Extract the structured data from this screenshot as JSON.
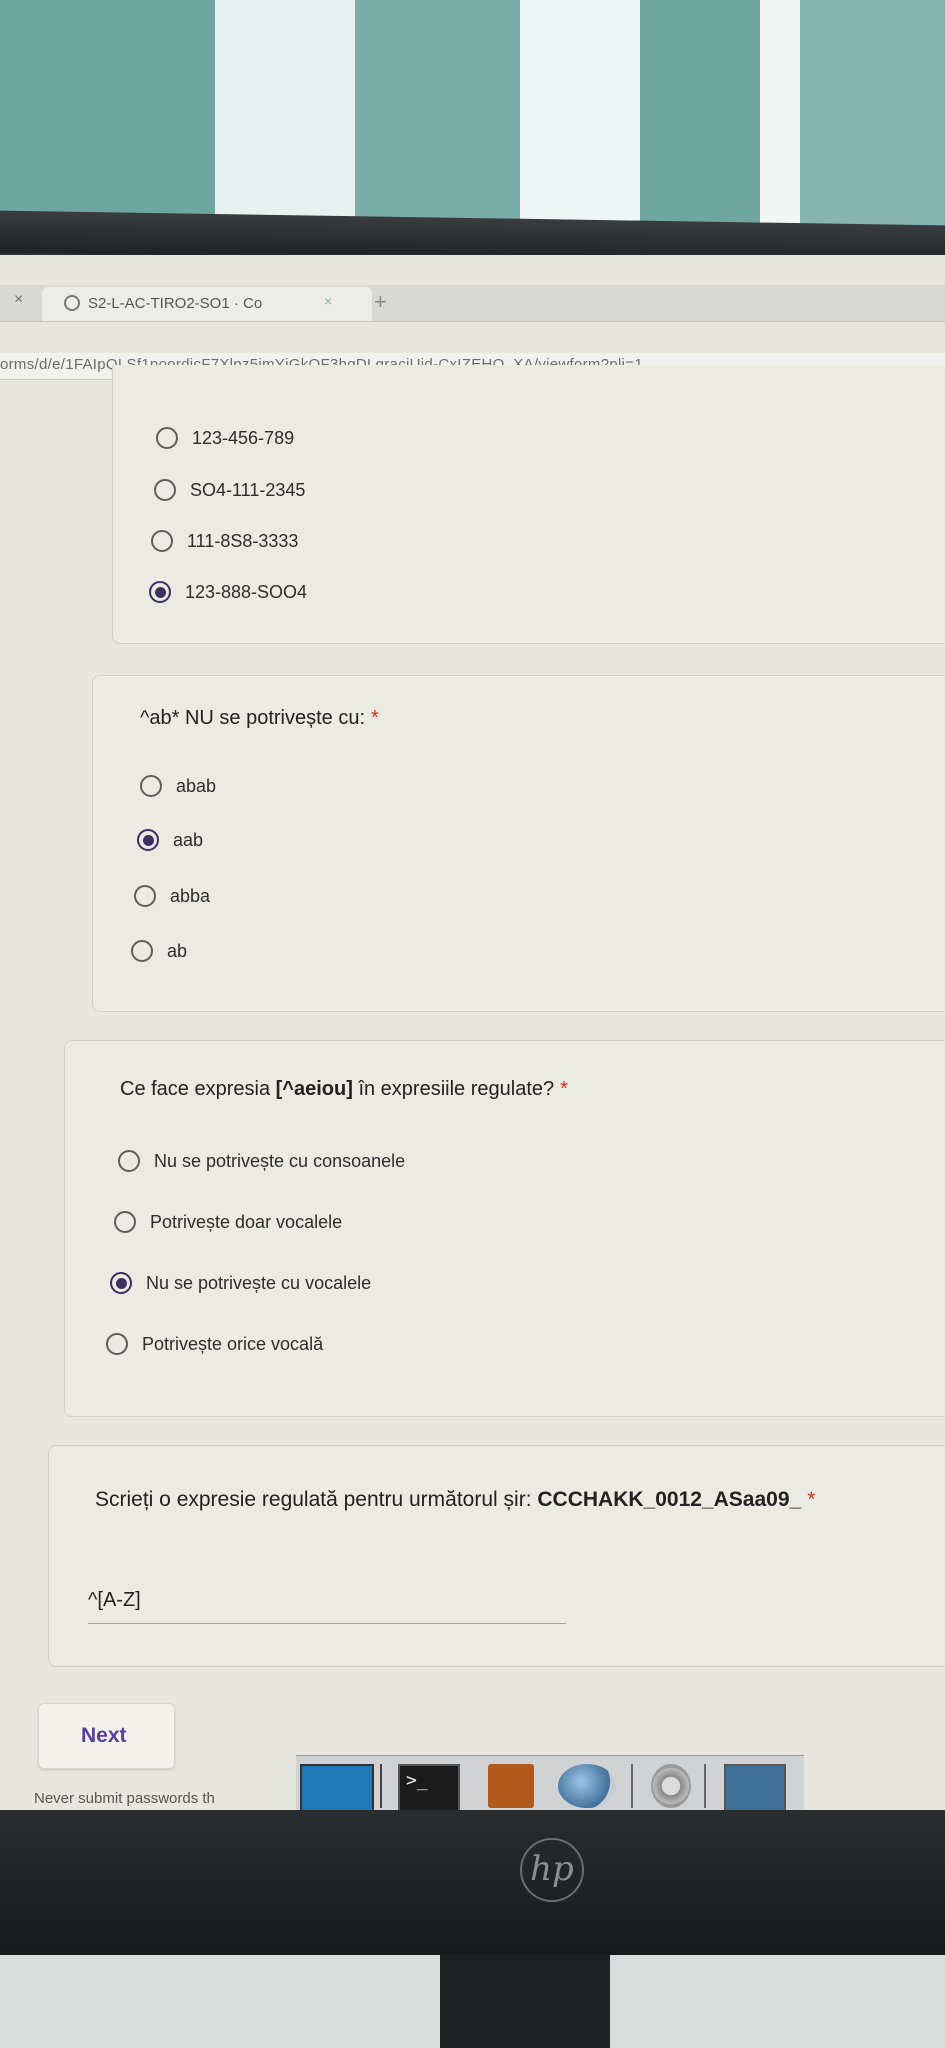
{
  "browser": {
    "tab_close": "×",
    "tab_title": "S2-L-AC-TIRO2-SO1 · Co",
    "tab_x": "×",
    "new_tab": "+",
    "url": "orms/d/e/1FAIpQLSf1poordjcF7Xlpz5imYjGkOF3hqDLgracjUid-CxIZEHO_XA/viewform?pli=1"
  },
  "questions": [
    {
      "title": "",
      "options": [
        {
          "label": "123-456-789",
          "selected": false
        },
        {
          "label": "SO4-111-2345",
          "selected": false
        },
        {
          "label": "111-8S8-3333",
          "selected": false
        },
        {
          "label": "123-888-SOO4",
          "selected": true
        }
      ]
    },
    {
      "title": "^ab* NU se potrivește cu:",
      "required": "*",
      "options": [
        {
          "label": "abab",
          "selected": false
        },
        {
          "label": "aab",
          "selected": true
        },
        {
          "label": "abba",
          "selected": false
        },
        {
          "label": "ab",
          "selected": false
        }
      ]
    },
    {
      "title_prefix": "Ce face expresia ",
      "title_bold": "[^aeiou]",
      "title_suffix": " în expresiile regulate?",
      "required": "*",
      "options": [
        {
          "label": "Nu se potrivește cu consoanele",
          "selected": false
        },
        {
          "label": "Potrivește doar vocalele",
          "selected": false
        },
        {
          "label": "Nu se potrivește cu vocalele",
          "selected": true
        },
        {
          "label": "Potrivește orice vocală",
          "selected": false
        }
      ]
    },
    {
      "title_prefix": "Scrieți o expresie regulată pentru următorul șir: ",
      "title_bold": "CCCHAKK_0012_ASaa09_",
      "required": "*",
      "answer_value": "^[A-Z]"
    }
  ],
  "form": {
    "next_label": "Next",
    "footer_text": "Never submit passwords th"
  },
  "taskbar": {
    "terminal_glyph": ">_"
  },
  "monitor": {
    "logo": "hp"
  }
}
